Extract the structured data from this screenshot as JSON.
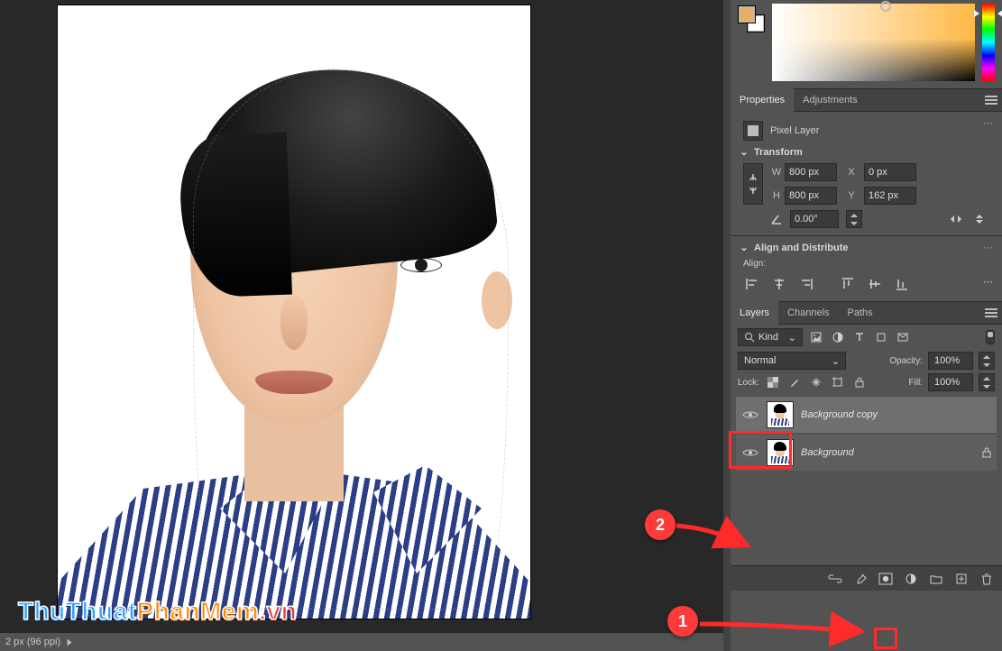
{
  "status_bar": {
    "text": "2 px (96 ppi)"
  },
  "watermark": {
    "a": "ThuThuat",
    "b": "PhanMem",
    "c": ".vn"
  },
  "color_panel": {
    "foreground": "#e4b06a",
    "background": "#ffffff"
  },
  "panels": {
    "properties_tabs": {
      "properties": "Properties",
      "adjustments": "Adjustments"
    },
    "pixel_layer_label": "Pixel Layer",
    "transform": {
      "title": "Transform",
      "w_label": "W",
      "w_value": "800 px",
      "h_label": "H",
      "h_value": "800 px",
      "x_label": "X",
      "x_value": "0 px",
      "y_label": "Y",
      "y_value": "162 px",
      "angle": "0.00°"
    },
    "align": {
      "title": "Align and Distribute",
      "sub": "Align:"
    }
  },
  "layers_panel": {
    "tabs": {
      "layers": "Layers",
      "channels": "Channels",
      "paths": "Paths"
    },
    "kind_label": "Kind",
    "blend_mode": "Normal",
    "opacity_label": "Opacity:",
    "opacity_value": "100%",
    "lock_label": "Lock:",
    "fill_label": "Fill:",
    "fill_value": "100%",
    "layers": [
      {
        "name": "Background copy",
        "visible": true,
        "locked": false,
        "selected": true
      },
      {
        "name": "Background",
        "visible": true,
        "locked": true,
        "selected": false
      }
    ]
  },
  "annotations": {
    "badge1": "1",
    "badge2": "2"
  }
}
